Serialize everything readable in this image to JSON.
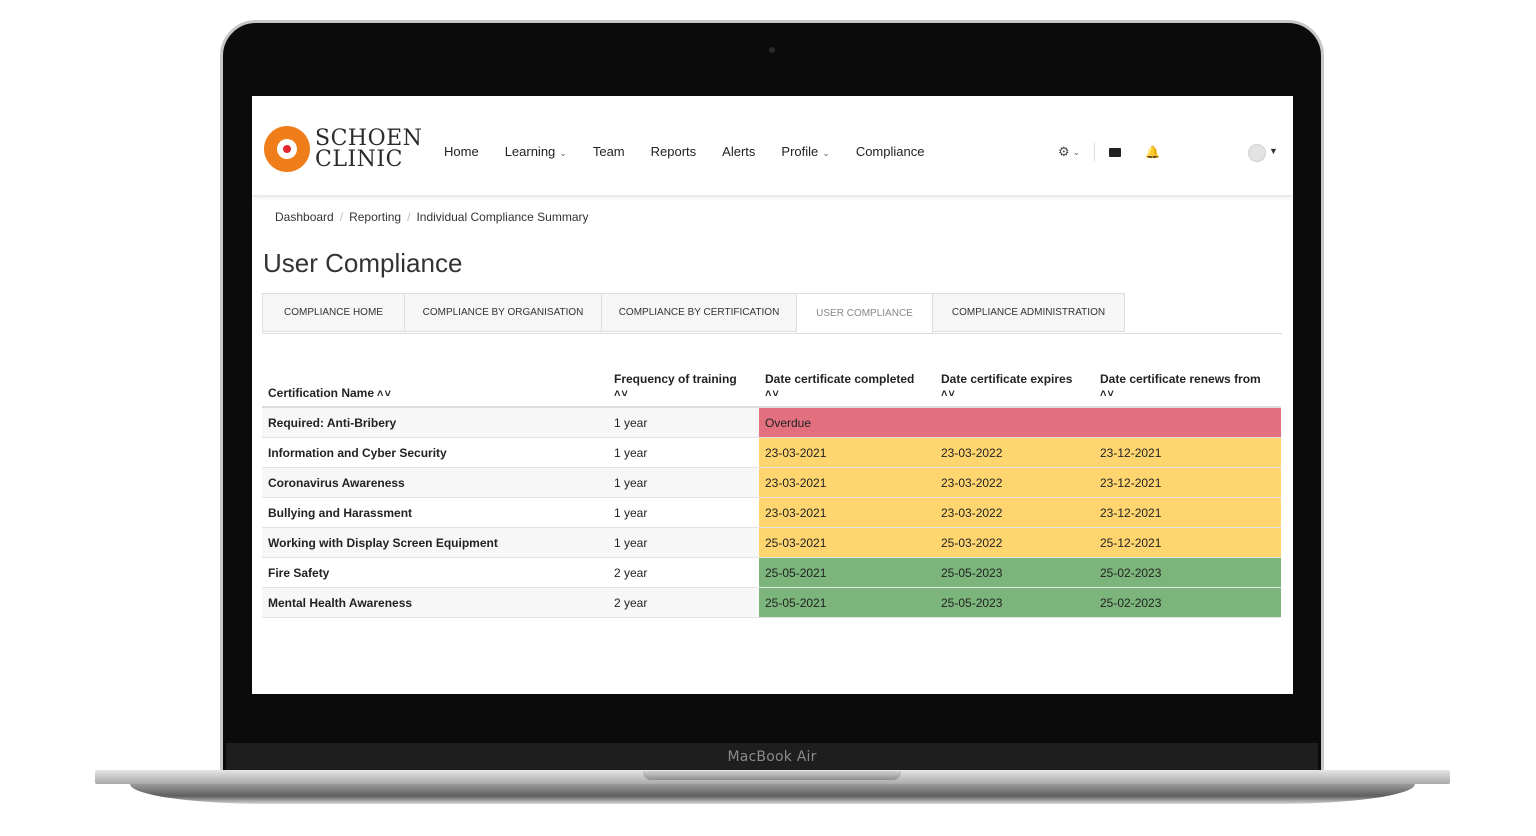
{
  "device": {
    "label": "MacBook Air"
  },
  "logo": {
    "line1": "SCHOEN",
    "line2": "CLINIC"
  },
  "nav": {
    "items": [
      {
        "label": "Home",
        "dropdown": false
      },
      {
        "label": "Learning",
        "dropdown": true
      },
      {
        "label": "Team",
        "dropdown": false
      },
      {
        "label": "Reports",
        "dropdown": false
      },
      {
        "label": "Alerts",
        "dropdown": false
      },
      {
        "label": "Profile",
        "dropdown": true
      },
      {
        "label": "Compliance",
        "dropdown": false
      }
    ],
    "icons": [
      "gear-icon",
      "mail-icon",
      "bell-icon",
      "avatar"
    ]
  },
  "breadcrumb": [
    "Dashboard",
    "Reporting",
    "Individual Compliance Summary"
  ],
  "page_title": "User Compliance",
  "tabs": [
    {
      "label": "COMPLIANCE HOME",
      "active": false
    },
    {
      "label": "COMPLIANCE BY ORGANISATION",
      "active": false
    },
    {
      "label": "COMPLIANCE BY CERTIFICATION",
      "active": false
    },
    {
      "label": "USER COMPLIANCE",
      "active": true
    },
    {
      "label": "COMPLIANCE ADMINISTRATION",
      "active": false
    }
  ],
  "table": {
    "headers": [
      "Certification Name",
      "Frequency of training",
      "Date certificate completed",
      "Date certificate expires",
      "Date certificate renews from"
    ],
    "rows": [
      {
        "name": "Required: Anti-Bribery",
        "frequency": "1 year",
        "completed": "Overdue",
        "expires": "",
        "renews": "",
        "status": "overdue"
      },
      {
        "name": "Information and Cyber Security",
        "frequency": "1 year",
        "completed": "23-03-2021",
        "expires": "23-03-2022",
        "renews": "23-12-2021",
        "status": "due-soon"
      },
      {
        "name": "Coronavirus Awareness",
        "frequency": "1 year",
        "completed": "23-03-2021",
        "expires": "23-03-2022",
        "renews": "23-12-2021",
        "status": "due-soon"
      },
      {
        "name": "Bullying and Harassment",
        "frequency": "1 year",
        "completed": "23-03-2021",
        "expires": "23-03-2022",
        "renews": "23-12-2021",
        "status": "due-soon"
      },
      {
        "name": "Working with Display Screen Equipment",
        "frequency": "1 year",
        "completed": "25-03-2021",
        "expires": "25-03-2022",
        "renews": "25-12-2021",
        "status": "due-soon"
      },
      {
        "name": "Fire Safety",
        "frequency": "2 year",
        "completed": "25-05-2021",
        "expires": "25-05-2023",
        "renews": "25-02-2023",
        "status": "compliant"
      },
      {
        "name": "Mental Health Awareness",
        "frequency": "2 year",
        "completed": "25-05-2021",
        "expires": "25-05-2023",
        "renews": "25-02-2023",
        "status": "compliant"
      }
    ]
  },
  "colors": {
    "overdue": "#e2707e",
    "due-soon": "#fed56f",
    "compliant": "#7cb57b",
    "brand_orange": "#ee7d1a",
    "brand_red": "#e3262f"
  }
}
